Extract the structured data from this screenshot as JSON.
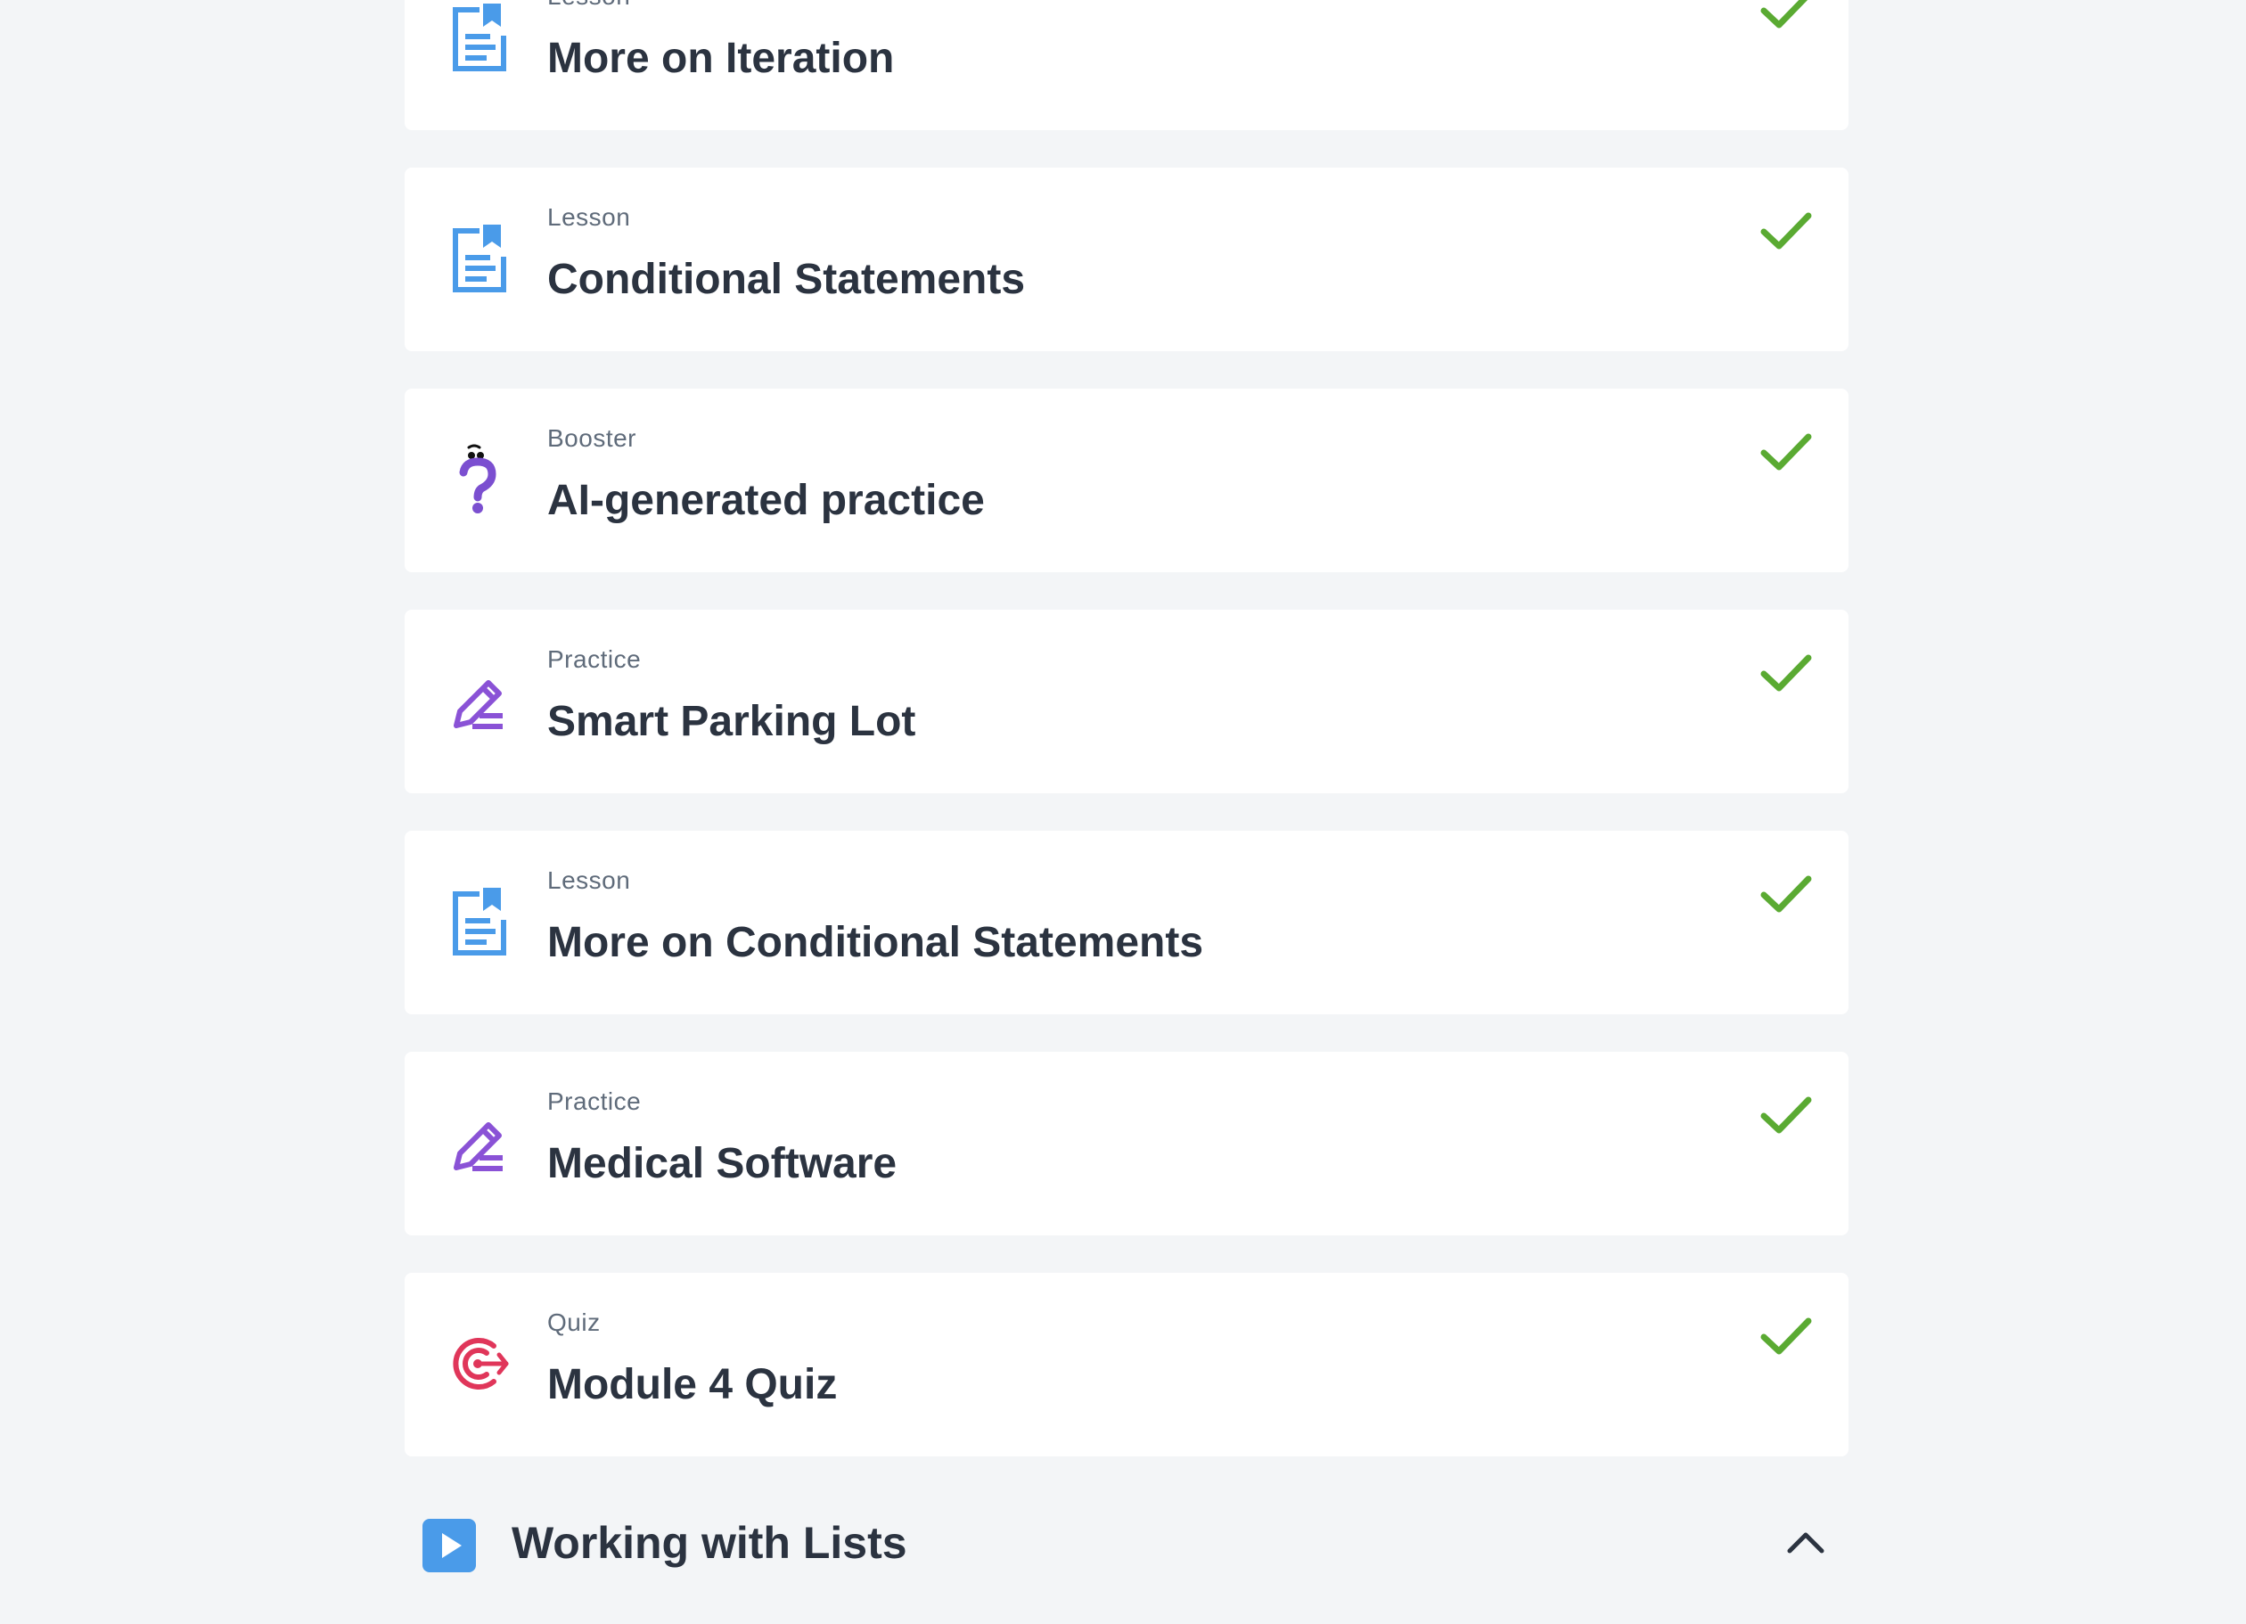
{
  "colors": {
    "page_background": "#f3f5f7",
    "card_background": "#ffffff",
    "title_text": "#2b3340",
    "type_text": "#5f6b7a",
    "lesson_icon": "#4a9be9",
    "practice_icon": "#8a52d6",
    "booster_icon": "#7b4fd0",
    "quiz_icon": "#e0365a",
    "check_icon": "#5aaa32",
    "section_play_icon": "#4a9be9"
  },
  "items": [
    {
      "type": "Lesson",
      "title": "More on Iteration",
      "icon": "lesson-icon",
      "completed": true
    },
    {
      "type": "Lesson",
      "title": "Conditional Statements",
      "icon": "lesson-icon",
      "completed": true
    },
    {
      "type": "Booster",
      "title": "AI-generated practice",
      "icon": "booster-question-icon",
      "completed": true
    },
    {
      "type": "Practice",
      "title": "Smart Parking Lot",
      "icon": "practice-pencil-icon",
      "completed": true
    },
    {
      "type": "Lesson",
      "title": "More on Conditional Statements",
      "icon": "lesson-icon",
      "completed": true
    },
    {
      "type": "Practice",
      "title": "Medical Software",
      "icon": "practice-pencil-icon",
      "completed": true
    },
    {
      "type": "Quiz",
      "title": "Module 4 Quiz",
      "icon": "quiz-target-icon",
      "completed": true
    }
  ],
  "next_section": {
    "title": "Working with Lists",
    "icon": "play-icon",
    "toggle_icon": "chevron-up-icon"
  }
}
